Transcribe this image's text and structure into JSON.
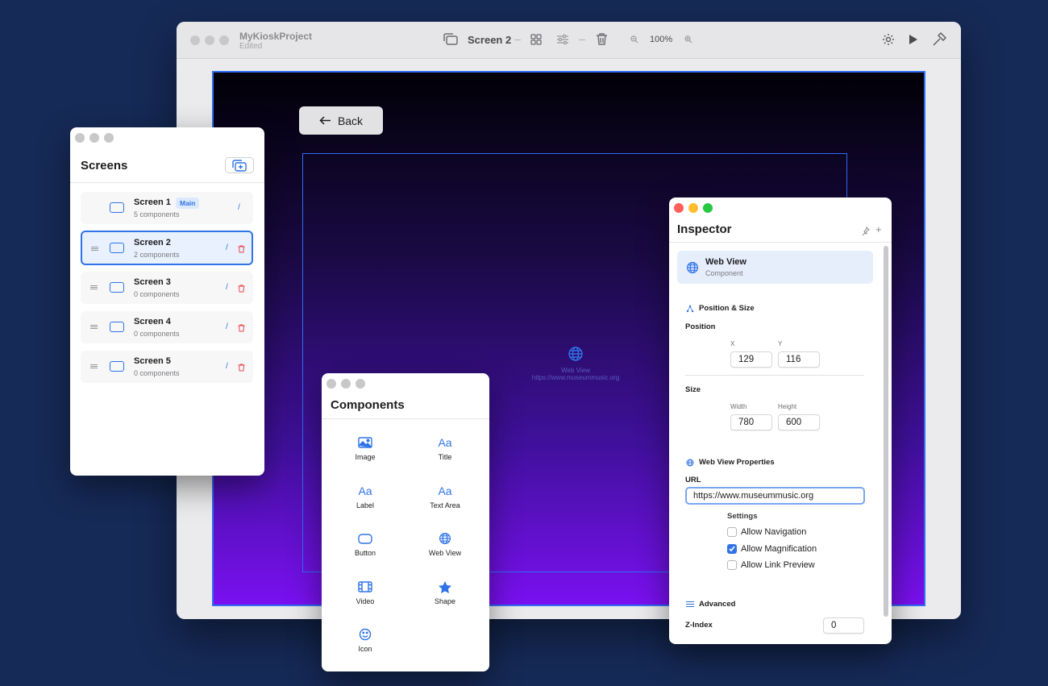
{
  "main_window": {
    "project_name": "MyKioskProject",
    "project_status": "Edited",
    "current_screen": "Screen 2",
    "zoom": "100%"
  },
  "canvas": {
    "back_button": "Back",
    "webview_label": "Web View",
    "webview_url": "https://www.museummusic.org"
  },
  "screens_panel": {
    "title": "Screens",
    "main_badge": "Main",
    "items": [
      {
        "name": "Screen 1",
        "count": "5 components"
      },
      {
        "name": "Screen 2",
        "count": "2 components"
      },
      {
        "name": "Screen 3",
        "count": "0 components"
      },
      {
        "name": "Screen 4",
        "count": "0 components"
      },
      {
        "name": "Screen 5",
        "count": "0 components"
      }
    ]
  },
  "components_panel": {
    "title": "Components",
    "items": [
      {
        "label": "Image",
        "icon": "image-icon"
      },
      {
        "label": "Title",
        "icon": "text-icon",
        "glyph": "Aa"
      },
      {
        "label": "Label",
        "icon": "text-icon",
        "glyph": "Aa"
      },
      {
        "label": "Text Area",
        "icon": "text-icon",
        "glyph": "Aa"
      },
      {
        "label": "Button",
        "icon": "button-icon"
      },
      {
        "label": "Web View",
        "icon": "globe-icon"
      },
      {
        "label": "Video",
        "icon": "film-icon"
      },
      {
        "label": "Shape",
        "icon": "star-icon"
      },
      {
        "label": "Icon",
        "icon": "smiley-icon"
      }
    ]
  },
  "inspector": {
    "title": "Inspector",
    "selected_name": "Web View",
    "selected_type": "Component",
    "pos_size_heading": "Position & Size",
    "position_label": "Position",
    "x_label": "X",
    "y_label": "Y",
    "x_value": "129",
    "y_value": "116",
    "size_label": "Size",
    "width_label": "Width",
    "height_label": "Height",
    "width_value": "780",
    "height_value": "600",
    "webview_props_heading": "Web View Properties",
    "url_label": "URL",
    "url_value": "https://www.museummusic.org",
    "settings_label": "Settings",
    "settings": [
      {
        "label": "Allow Navigation",
        "checked": false
      },
      {
        "label": "Allow Magnification",
        "checked": true
      },
      {
        "label": "Allow Link Preview",
        "checked": false
      }
    ],
    "advanced_heading": "Advanced",
    "zindex_label": "Z-Index",
    "zindex_value": "0"
  },
  "colors": {
    "accent": "#2f73e6",
    "background": "#162a57",
    "delete": "#e5484d"
  }
}
